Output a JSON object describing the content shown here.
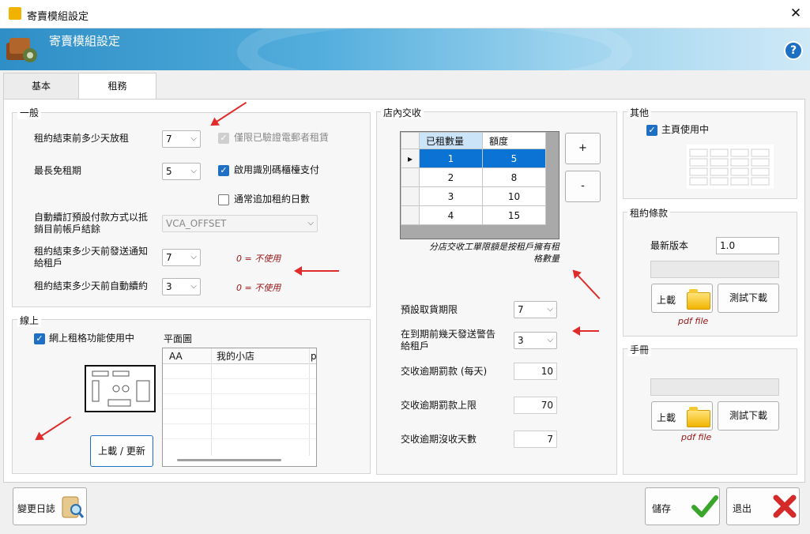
{
  "window": {
    "title": "寄賣模組設定",
    "close_glyph": "✕"
  },
  "banner": {
    "title": "寄賣模組設定",
    "help_glyph": "?"
  },
  "tabs": [
    {
      "label": "基本",
      "active": false
    },
    {
      "label": "租務",
      "active": true
    }
  ],
  "general": {
    "legend": "一般",
    "rows": [
      {
        "label": "租約結束前多少天放租",
        "value": "7"
      },
      {
        "label": "最長免租期",
        "value": "5"
      },
      {
        "label": "自動續訂預設付款方式以抵銷目前帳戶結餘",
        "value": "VCA_OFFSET"
      },
      {
        "label": "租約結束多少天前發送通知給租戶",
        "value": "7",
        "note": "0 = 不使用"
      },
      {
        "label": "租約結束多少天前自動續約",
        "value": "3",
        "note": "0 = 不使用"
      }
    ],
    "checks": [
      {
        "label": "僅限已驗證電郵者租賃",
        "checked": true,
        "disabled": true
      },
      {
        "label": "啟用識別碼櫃檯支付",
        "checked": true
      },
      {
        "label": "通常追加租約日數",
        "checked": false
      }
    ]
  },
  "online": {
    "legend": "線上",
    "check_label": "網上租格功能使用中",
    "check_checked": true,
    "floor_plan_label": "平面圖",
    "upload_button": "上載 / 更新",
    "table_headers": [
      "AA",
      "我的小店",
      "p"
    ]
  },
  "instore": {
    "legend": "店內交收",
    "grid_headers": [
      "已租數量",
      "額度"
    ],
    "grid_rows": [
      [
        "1",
        "5"
      ],
      [
        "2",
        "8"
      ],
      [
        "3",
        "10"
      ],
      [
        "4",
        "15"
      ]
    ],
    "add_glyph": "+",
    "remove_glyph": "-",
    "grid_note": "分店交收工單限額是按租戶擁有租格數量",
    "fields": [
      {
        "label": "預設取貨期限",
        "value": "7"
      },
      {
        "label": "在到期前幾天發送警告給租戶",
        "value": "3"
      },
      {
        "label": "交收逾期罰款 (每天)",
        "value": "10"
      },
      {
        "label": "交收逾期罰款上限",
        "value": "70"
      },
      {
        "label": "交收逾期沒收天數",
        "value": "7"
      }
    ]
  },
  "other": {
    "legend": "其他",
    "check_label": "主頁使用中",
    "check_checked": true
  },
  "terms": {
    "legend": "租約條款",
    "version_label": "最新版本",
    "version_value": "1.0",
    "upload_label": "上載",
    "test_download_label": "測試下載",
    "pdf_label": "pdf file"
  },
  "manual": {
    "legend": "手冊",
    "upload_label": "上載",
    "test_download_label": "測試下載",
    "pdf_label": "pdf file"
  },
  "footer": {
    "changelog_label": "變更日誌",
    "save_label": "儲存",
    "exit_label": "退出"
  },
  "colors": {
    "accent": "#1f6fc5",
    "selection": "#0a73d4",
    "note_red": "#9b1414",
    "arrow_red": "#e02b2b"
  }
}
